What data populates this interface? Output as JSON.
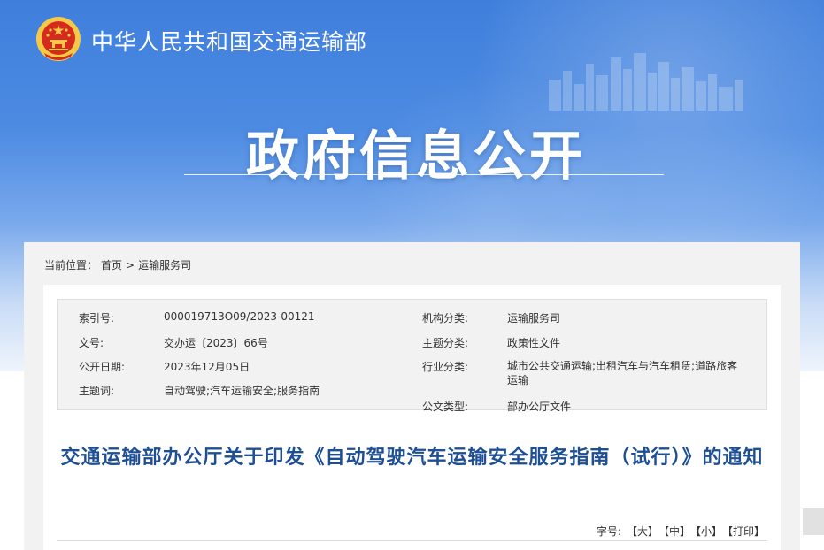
{
  "site": {
    "title": "中华人民共和国交通运输部",
    "hero_title": "政府信息公开"
  },
  "breadcrumb": {
    "label": "当前位置：",
    "home": "首页",
    "separator": ">",
    "current": "运输服务司"
  },
  "meta": {
    "index_no_label": "索引号:",
    "index_no": "000019713O09/2023-00121",
    "doc_no_label": "文号:",
    "doc_no": "交办运〔2023〕66号",
    "date_label": "公开日期:",
    "date": "2023年12月05日",
    "subject_label": "主题词:",
    "subject": "自动驾驶;汽车运输安全;服务指南",
    "org_label": "机构分类:",
    "org": "运输服务司",
    "topic_label": "主题分类:",
    "topic": "政策性文件",
    "industry_label": "行业分类:",
    "industry": "城市公共交通运输;出租汽车与汽车租赁;道路旅客运输",
    "doctype_label": "公文类型:",
    "doctype": "部办公厅文件"
  },
  "document": {
    "title": "交通运输部办公厅关于印发《自动驾驶汽车运输安全服务指南（试行）》的通知"
  },
  "font_controls": {
    "label": "字号:",
    "large": "【大】",
    "medium": "【中】",
    "small": "【小】",
    "print": "【打印】"
  },
  "colors": {
    "banner_blue": "#4d8be2",
    "title_blue": "#1f4f93",
    "emblem_red": "#d52b1e",
    "emblem_gold": "#f6c945"
  }
}
